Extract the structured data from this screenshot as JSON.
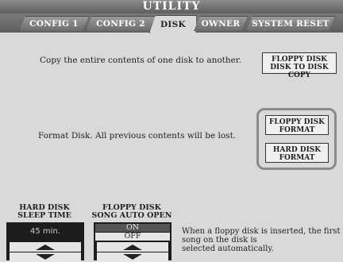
{
  "title": "UTILITY",
  "tabs": [
    {
      "label": "CONFIG 1"
    },
    {
      "label": "CONFIG 2"
    },
    {
      "label": "DISK"
    },
    {
      "label": "OWNER"
    },
    {
      "label": "SYSTEM RESET"
    }
  ],
  "copy_description": "Copy the entire contents of one disk to another.",
  "floppy_copy_button": {
    "line1": "FLOPPY DISK",
    "line2": "DISK TO DISK COPY"
  },
  "format_description": "Format Disk. All previous contents will be lost.",
  "floppy_format_button": {
    "line1": "FLOPPY DISK",
    "line2": "FORMAT"
  },
  "hard_format_button": {
    "line1": "HARD DISK",
    "line2": "FORMAT"
  },
  "sleep_time": {
    "label_line1": "HARD DISK",
    "label_line2": "SLEEP TIME",
    "value": "45 min."
  },
  "auto_open": {
    "label_line1": "FLOPPY DISK",
    "label_line2": "SONG AUTO OPEN",
    "options": [
      "ON",
      "OFF"
    ],
    "selected": "OFF"
  },
  "auto_open_description": [
    "When a floppy disk is inserted, the first",
    "song on the disk is",
    "selected automatically."
  ]
}
